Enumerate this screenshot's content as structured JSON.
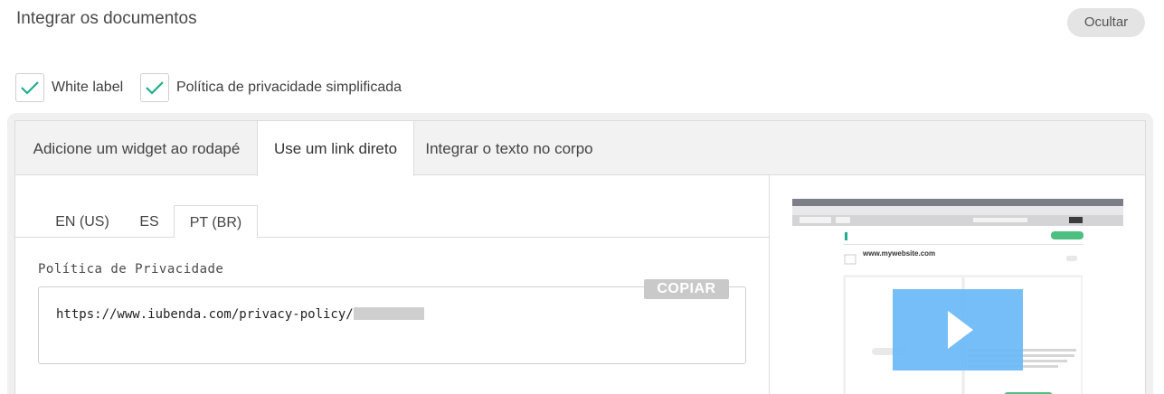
{
  "header": {
    "title": "Integrar os documentos",
    "hide_label": "Ocultar"
  },
  "options": [
    {
      "label": "White label",
      "checked": true
    },
    {
      "label": "Política de privacidade simplificada",
      "checked": true
    }
  ],
  "colors": {
    "check": "#1fae8c",
    "play_overlay": "#6ab8f7",
    "copy_button": "#c9c9c9"
  },
  "tabs": [
    {
      "label": "Adicione um widget ao rodapé",
      "active": false
    },
    {
      "label": "Use um link direto",
      "active": true
    },
    {
      "label": "Integrar o texto no corpo",
      "active": false
    }
  ],
  "languages": [
    {
      "label": "EN (US)",
      "active": false
    },
    {
      "label": "ES",
      "active": false
    },
    {
      "label": "PT (BR)",
      "active": true
    }
  ],
  "privacy_field": {
    "label": "Política de Privacidade",
    "url": "https://www.iubenda.com/privacy-policy/",
    "copy_label": "COPIAR"
  },
  "video": {
    "icon": "play-icon",
    "site_label": "www.mywebsite.com"
  }
}
